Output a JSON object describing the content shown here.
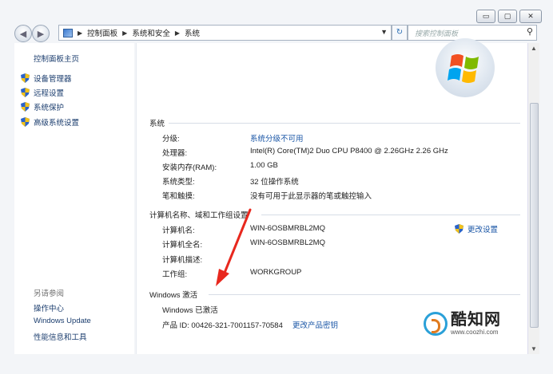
{
  "window": {
    "controls": [
      "▭",
      "▢",
      "✕"
    ]
  },
  "address": {
    "crumbs": [
      "控制面板",
      "系统和安全",
      "系统"
    ],
    "search_placeholder": "搜索控制面板"
  },
  "sidebar": {
    "home": "控制面板主页",
    "items": [
      {
        "label": "设备管理器",
        "icon": "shield-icon"
      },
      {
        "label": "远程设置",
        "icon": "shield-icon"
      },
      {
        "label": "系统保护",
        "icon": "shield-icon"
      },
      {
        "label": "高级系统设置",
        "icon": "shield-icon"
      }
    ],
    "see_also": "另请参阅",
    "links": [
      "操作中心",
      "Windows Update",
      "性能信息和工具"
    ]
  },
  "system": {
    "heading": "系统",
    "rows": [
      {
        "label": "分级:",
        "value": "系统分级不可用",
        "is_link": true
      },
      {
        "label": "处理器:",
        "value": "Intel(R) Core(TM)2 Duo CPU    P8400  @ 2.26GHz   2.26 GHz",
        "is_link": false
      },
      {
        "label": "安装内存(RAM):",
        "value": "1.00 GB",
        "is_link": false
      },
      {
        "label": "系统类型:",
        "value": "32 位操作系统",
        "is_link": false
      },
      {
        "label": "笔和触摸:",
        "value": "没有可用于此显示器的笔或触控输入",
        "is_link": false
      }
    ]
  },
  "computer": {
    "heading": "计算机名称、域和工作组设置",
    "change_settings": "更改设置",
    "rows": [
      {
        "label": "计算机名:",
        "value": "WIN-6OSBMRBL2MQ"
      },
      {
        "label": "计算机全名:",
        "value": "WIN-6OSBMRBL2MQ"
      },
      {
        "label": "计算机描述:",
        "value": ""
      },
      {
        "label": "工作组:",
        "value": "WORKGROUP"
      }
    ]
  },
  "activation": {
    "heading": "Windows 激活",
    "status": "Windows 已激活",
    "product_id": "产品 ID: 00426-321-7001157-70584",
    "change_key": "更改产品密钥"
  },
  "watermark": {
    "brand": "酷知网",
    "url": "www.coozhi.com"
  },
  "colors": {
    "link": "#1a56a6",
    "arrow": "#e8281e",
    "shield_blue": "#2a63c9",
    "shield_yellow": "#f2c21a"
  }
}
